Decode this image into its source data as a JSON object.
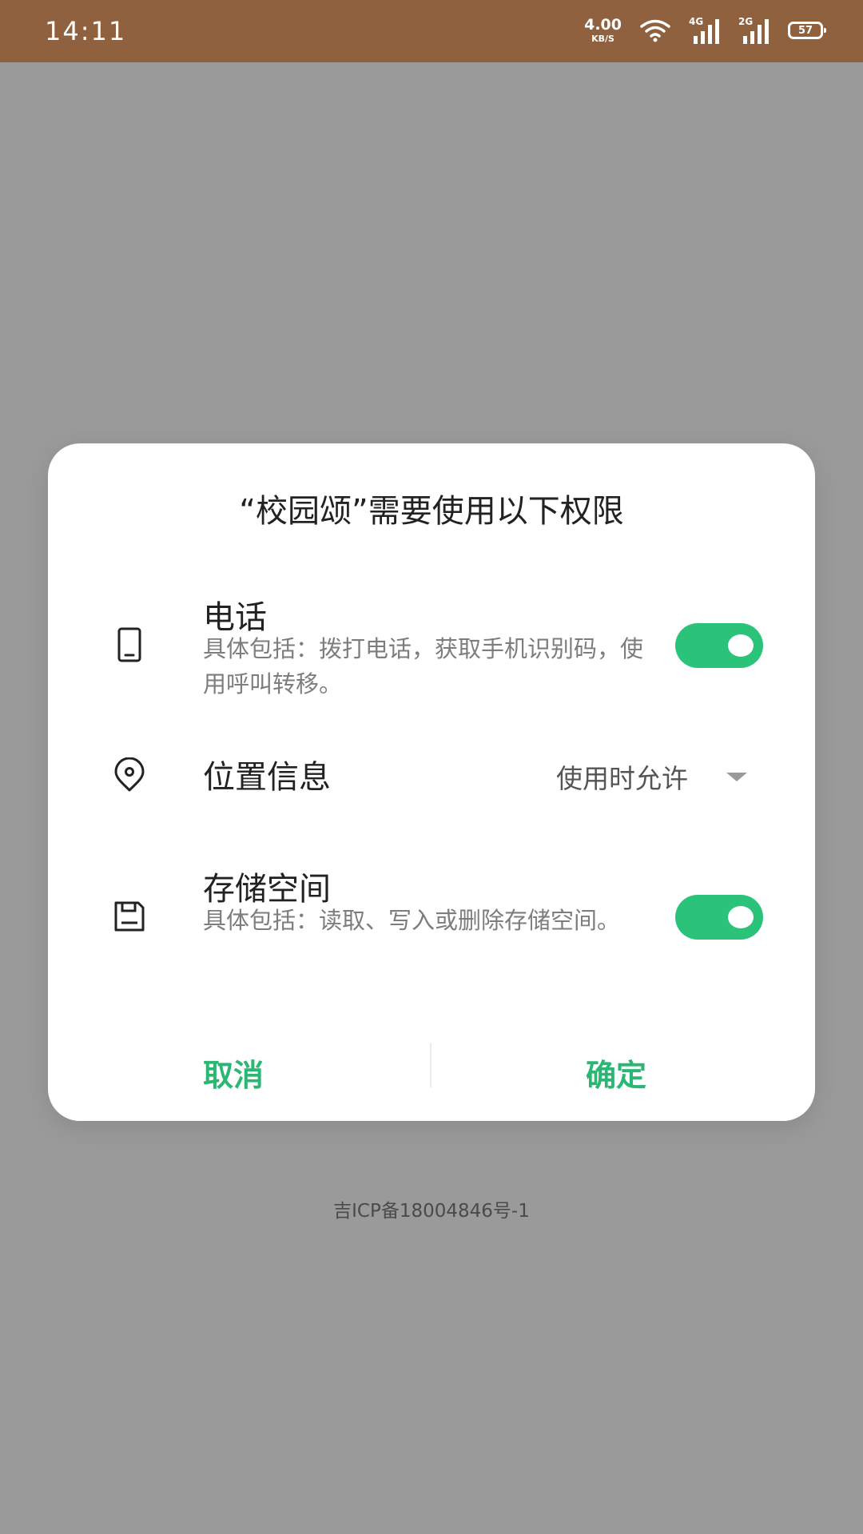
{
  "status_bar": {
    "time": "14:11",
    "net_speed_value": "4.00",
    "net_speed_unit": "KB/S",
    "signal_1_gen": "4G",
    "signal_2_gen": "2G",
    "battery": "57",
    "icons": [
      "wifi-icon",
      "signal-icon",
      "signal-icon",
      "battery-icon"
    ]
  },
  "dialog": {
    "title": "“校园颂”需要使用以下权限",
    "permissions": [
      {
        "icon": "phone-icon",
        "title": "电话",
        "description": "具体包括：拨打电话，获取手机识别码，使用呼叫转移。",
        "enabled": true
      },
      {
        "icon": "location-icon",
        "title": "位置信息",
        "value": "使用时允许"
      },
      {
        "icon": "storage-icon",
        "title": "存储空间",
        "description": "具体包括：读取、写入或删除存储空间。",
        "enabled": true
      }
    ],
    "cancel_label": "取消",
    "confirm_label": "确定"
  },
  "footer": {
    "icp": "吉ICP备18004846号-1"
  },
  "colors": {
    "accent": "#2bc27a",
    "status_bar": "#8f613e",
    "overlay": "#9a9a9a"
  }
}
